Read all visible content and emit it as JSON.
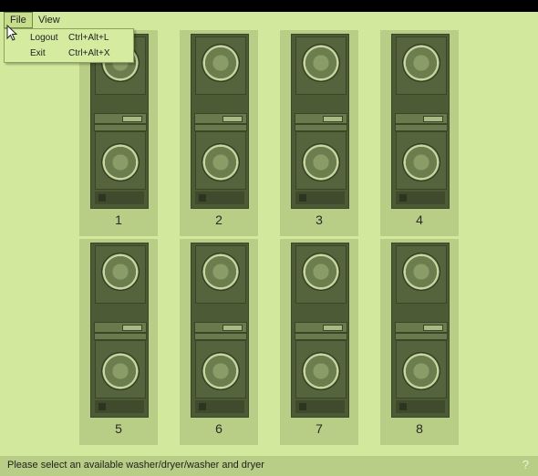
{
  "menubar": {
    "items": [
      {
        "label": "File"
      },
      {
        "label": "View"
      }
    ]
  },
  "file_menu": {
    "items": [
      {
        "label": "Logout",
        "shortcut": "Ctrl+Alt+L"
      },
      {
        "label": "Exit",
        "shortcut": "Ctrl+Alt+X"
      }
    ]
  },
  "machines": [
    {
      "number": "1"
    },
    {
      "number": "2"
    },
    {
      "number": "3"
    },
    {
      "number": "4"
    },
    {
      "number": "5"
    },
    {
      "number": "6"
    },
    {
      "number": "7"
    },
    {
      "number": "8"
    }
  ],
  "status": {
    "message": "Please select an available washer/dryer/washer and dryer",
    "help_label": "?"
  },
  "colors": {
    "background": "#d2e89c",
    "tile": "#b8cd85",
    "machine": "#4c5a36"
  }
}
